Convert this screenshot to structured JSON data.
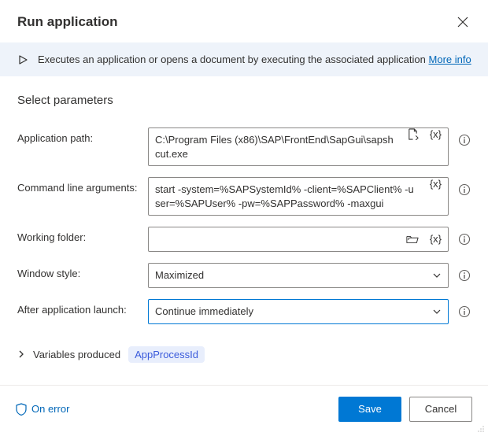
{
  "header": {
    "title": "Run application"
  },
  "infobar": {
    "text": "Executes an application or opens a document by executing the associated application",
    "more": "More info"
  },
  "section_title": "Select parameters",
  "labels": {
    "app_path": "Application path:",
    "cmd_args": "Command line arguments:",
    "working_folder": "Working folder:",
    "window_style": "Window style:",
    "after_launch": "After application launch:"
  },
  "values": {
    "app_path": "C:\\Program Files (x86)\\SAP\\FrontEnd\\SapGui\\sapshcut.exe",
    "cmd_args": "start -system=%SAPSystemId% -client=%SAPClient% -user=%SAPUser% -pw=%SAPPassword% -maxgui",
    "working_folder": "",
    "window_style": "Maximized",
    "after_launch": "Continue immediately"
  },
  "variables": {
    "label": "Variables produced",
    "items": [
      "AppProcessId"
    ]
  },
  "footer": {
    "on_error": "On error",
    "save": "Save",
    "cancel": "Cancel"
  },
  "tokens": {
    "vartoken": "{x}"
  }
}
